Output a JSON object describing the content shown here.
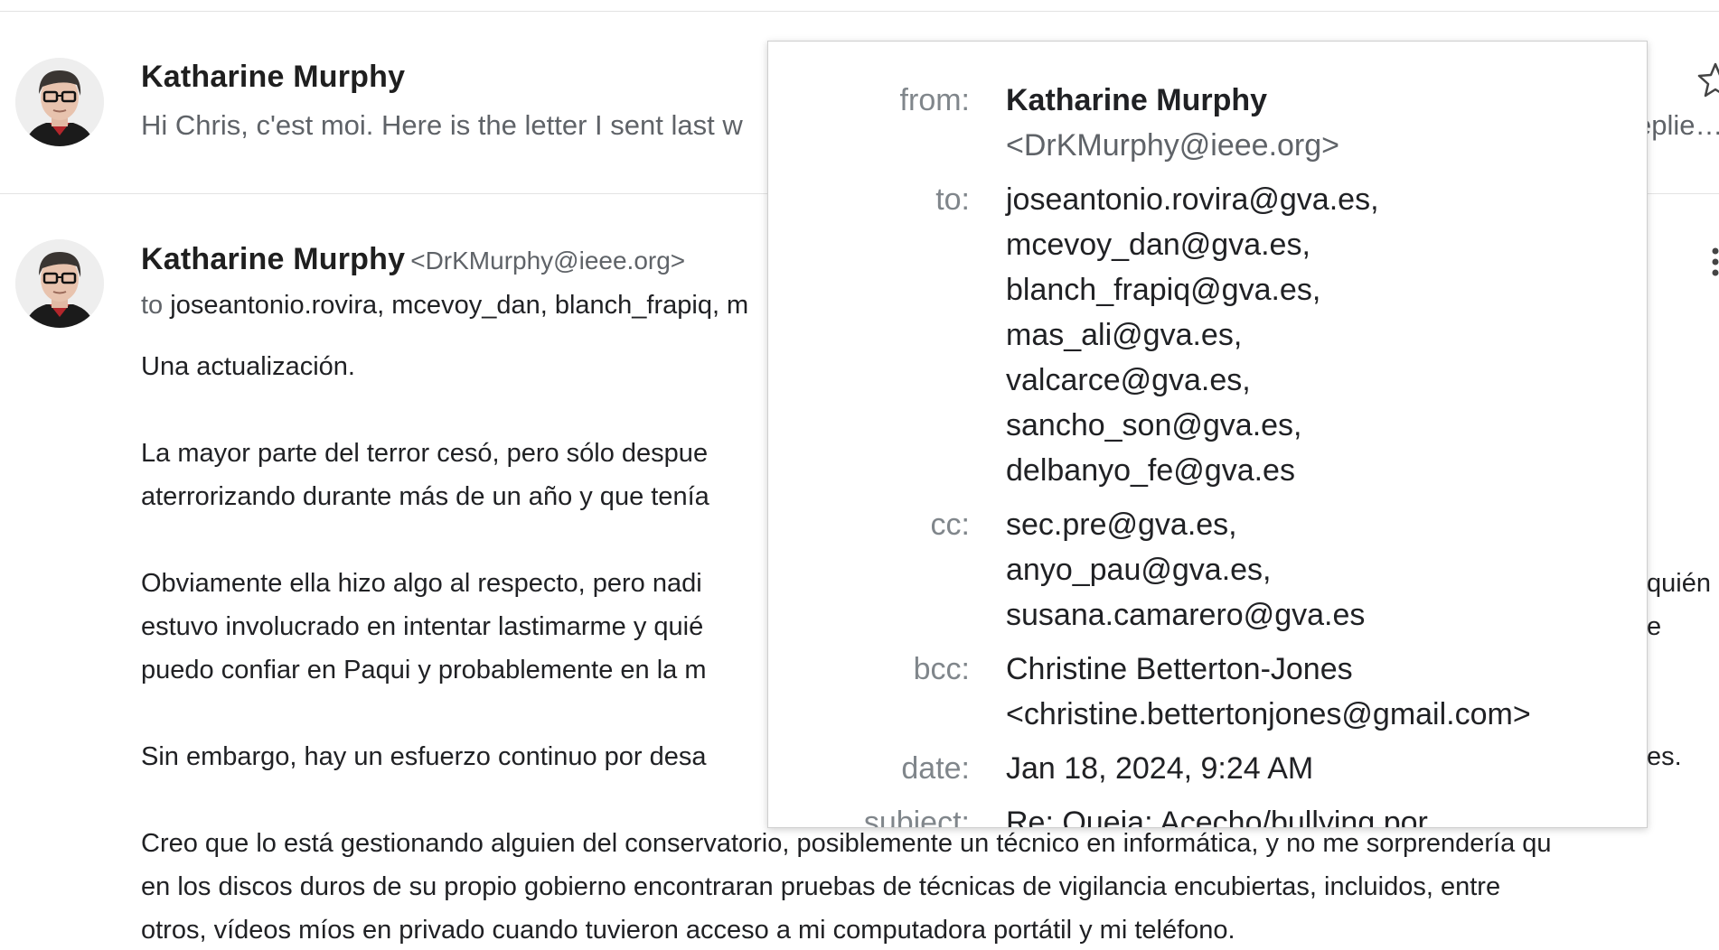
{
  "thread": {
    "collapsed_message": {
      "sender": "Katharine Murphy",
      "snippet": "Hi Chris, c'est moi. Here is the letter I sent last w",
      "snippet_tail": "eplie…"
    },
    "expanded_message": {
      "sender": "Katharine Murphy",
      "sender_email": "<DrKMurphy@ieee.org>",
      "to_label": "to",
      "to_names": "joseantonio.rovira, mcevoy_dan, blanch_frapiq, m",
      "body": [
        "Una actualización.",
        "La mayor parte del terror cesó, pero sólo despue",
        "aterrorizando durante más de un año y que tenía",
        "Obviamente ella hizo algo al respecto, pero nadi",
        "quién",
        "estuvo involucrado en intentar lastimarme y quié",
        "e",
        "puedo confiar en Paqui y probablemente en la m",
        "Sin embargo, hay un esfuerzo continuo por desa",
        "es.",
        "Creo que lo está gestionando alguien del conservatorio, posiblemente un técnico en informática, y no me sorprendería qu",
        "en los discos duros de su propio gobierno encontraran pruebas de técnicas de vigilancia encubiertas, incluidos, entre",
        "otros, vídeos míos en privado cuando tuvieron acceso a mi computadora portátil y mi teléfono."
      ]
    }
  },
  "details_popup": {
    "labels": {
      "from": "from:",
      "to": "to:",
      "cc": "cc:",
      "bcc": "bcc:",
      "date": "date:",
      "subject": "subject:"
    },
    "from_name": "Katharine Murphy",
    "from_email": "<DrKMurphy@ieee.org>",
    "to": [
      "joseantonio.rovira@gva.es,",
      "mcevoy_dan@gva.es,",
      "blanch_frapiq@gva.es,",
      "mas_ali@gva.es,",
      "valcarce@gva.es,",
      "sancho_son@gva.es,",
      "delbanyo_fe@gva.es"
    ],
    "cc": [
      "sec.pre@gva.es,",
      "anyo_pau@gva.es,",
      "susana.camarero@gva.es"
    ],
    "bcc_name": "Christine Betterton-Jones",
    "bcc_email": "<christine.bettertonjones@gmail.com>",
    "date": "Jan 18, 2024, 9:24 AM",
    "subject": "Re: Queja: Acecho/bullying por"
  },
  "icons": {
    "star": "star-icon",
    "more": "more-vert-icon",
    "avatar": "avatar"
  }
}
